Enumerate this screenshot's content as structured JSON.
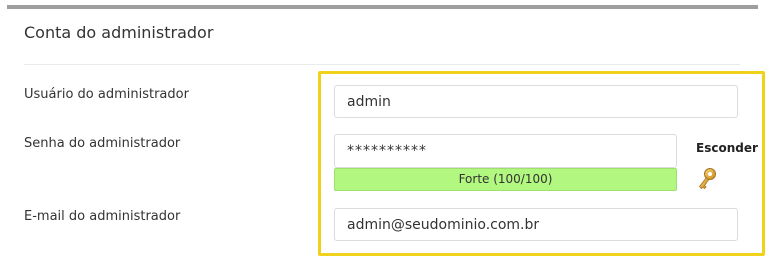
{
  "section": {
    "title": "Conta do administrador"
  },
  "fields": {
    "username": {
      "label": "Usuário do administrador",
      "value": "admin"
    },
    "password": {
      "label": "Senha do administrador",
      "value": "**********",
      "strength_text": "Forte (100/100)",
      "strength_score": 100,
      "hide_label": "Esconder",
      "generate_icon": "key-icon"
    },
    "email": {
      "label": "E-mail do administrador",
      "value": "admin@seudominio.com.br"
    }
  },
  "colors": {
    "highlight": "#f0d21c",
    "strength_bar": "#b2f77f"
  }
}
